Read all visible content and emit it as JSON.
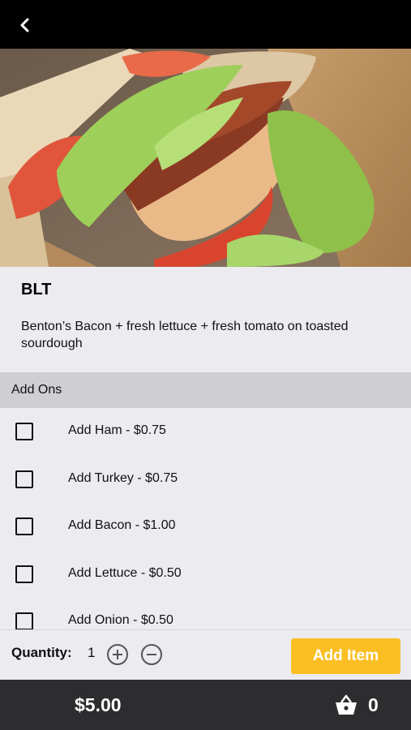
{
  "header": {
    "back_icon": "chevron-left-icon"
  },
  "item": {
    "name": "BLT",
    "description": "Benton’s Bacon + fresh lettuce + fresh tomato on toasted sourdough"
  },
  "addons": {
    "header": "Add Ons",
    "options": [
      {
        "label": "Add Ham - $0.75",
        "checked": false
      },
      {
        "label": "Add Turkey - $0.75",
        "checked": false
      },
      {
        "label": "Add Bacon - $1.00",
        "checked": false
      },
      {
        "label": "Add Lettuce - $0.50",
        "checked": false
      },
      {
        "label": "Add Onion - $0.50",
        "checked": false
      }
    ]
  },
  "quantity": {
    "label": "Quantity:",
    "value": "1",
    "plus_icon": "plus-circle-icon",
    "minus_icon": "minus-circle-icon"
  },
  "add_button": "Add Item",
  "footer": {
    "total": "$5.00",
    "cart_icon": "shopping-basket-icon",
    "cart_count": "0"
  },
  "colors": {
    "accent": "#fbbf24",
    "topbar": "#000000",
    "footer": "#2d2d2f",
    "background": "#ebebf0",
    "section_header": "#cfcfd3"
  }
}
